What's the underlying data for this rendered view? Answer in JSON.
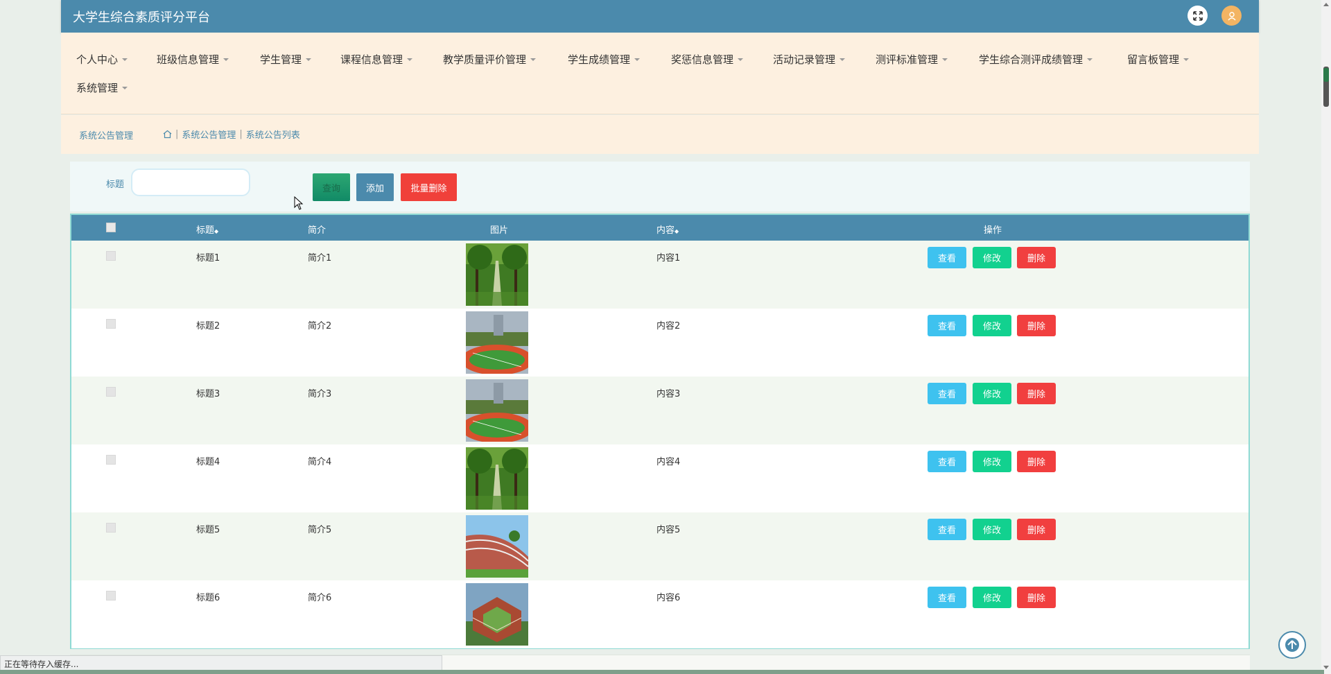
{
  "header": {
    "title": "大学生综合素质评分平台",
    "fullscreen_icon": "expand-icon",
    "avatar_icon": "user-icon"
  },
  "nav": {
    "items": [
      {
        "label": "个人中心"
      },
      {
        "label": "班级信息管理"
      },
      {
        "label": "学生管理"
      },
      {
        "label": "课程信息管理"
      },
      {
        "label": "教学质量评价管理"
      },
      {
        "label": "学生成绩管理"
      },
      {
        "label": "奖惩信息管理"
      },
      {
        "label": "活动记录管理"
      },
      {
        "label": "测评标准管理"
      },
      {
        "label": "学生综合测评成绩管理"
      },
      {
        "label": "留言板管理"
      },
      {
        "label": "系统管理"
      }
    ]
  },
  "breadcrumb": {
    "page_title": "系统公告管理",
    "path": [
      "系统公告管理",
      "系统公告列表"
    ]
  },
  "search": {
    "label": "标题",
    "value": "",
    "placeholder": "",
    "search_button": "查询",
    "add_button": "添加",
    "batch_delete_button": "批量删除"
  },
  "table": {
    "columns": [
      "标题",
      "简介",
      "图片",
      "内容",
      "操作"
    ],
    "sortable_marker": "◆",
    "rows": [
      {
        "title": "标题1",
        "intro": "简介1",
        "content": "内容1",
        "image": "tree-lined-path"
      },
      {
        "title": "标题2",
        "intro": "简介2",
        "content": "内容2",
        "image": "sports-field"
      },
      {
        "title": "标题3",
        "intro": "简介3",
        "content": "内容3",
        "image": "sports-field"
      },
      {
        "title": "标题4",
        "intro": "简介4",
        "content": "内容4",
        "image": "tree-lined-path"
      },
      {
        "title": "标题5",
        "intro": "简介5",
        "content": "内容5",
        "image": "campus-building"
      },
      {
        "title": "标题6",
        "intro": "简介6",
        "content": "内容6",
        "image": "campus-aerial"
      }
    ],
    "row_actions": {
      "view": "查看",
      "edit": "修改",
      "delete": "删除"
    }
  },
  "statusbar": {
    "text": "正在等待存入缓存..."
  },
  "colors": {
    "primary": "#4b8aac",
    "nav_bg": "#fdf0e0",
    "view": "#3ec2ef",
    "edit": "#12d18f",
    "delete": "#f13f3f"
  }
}
